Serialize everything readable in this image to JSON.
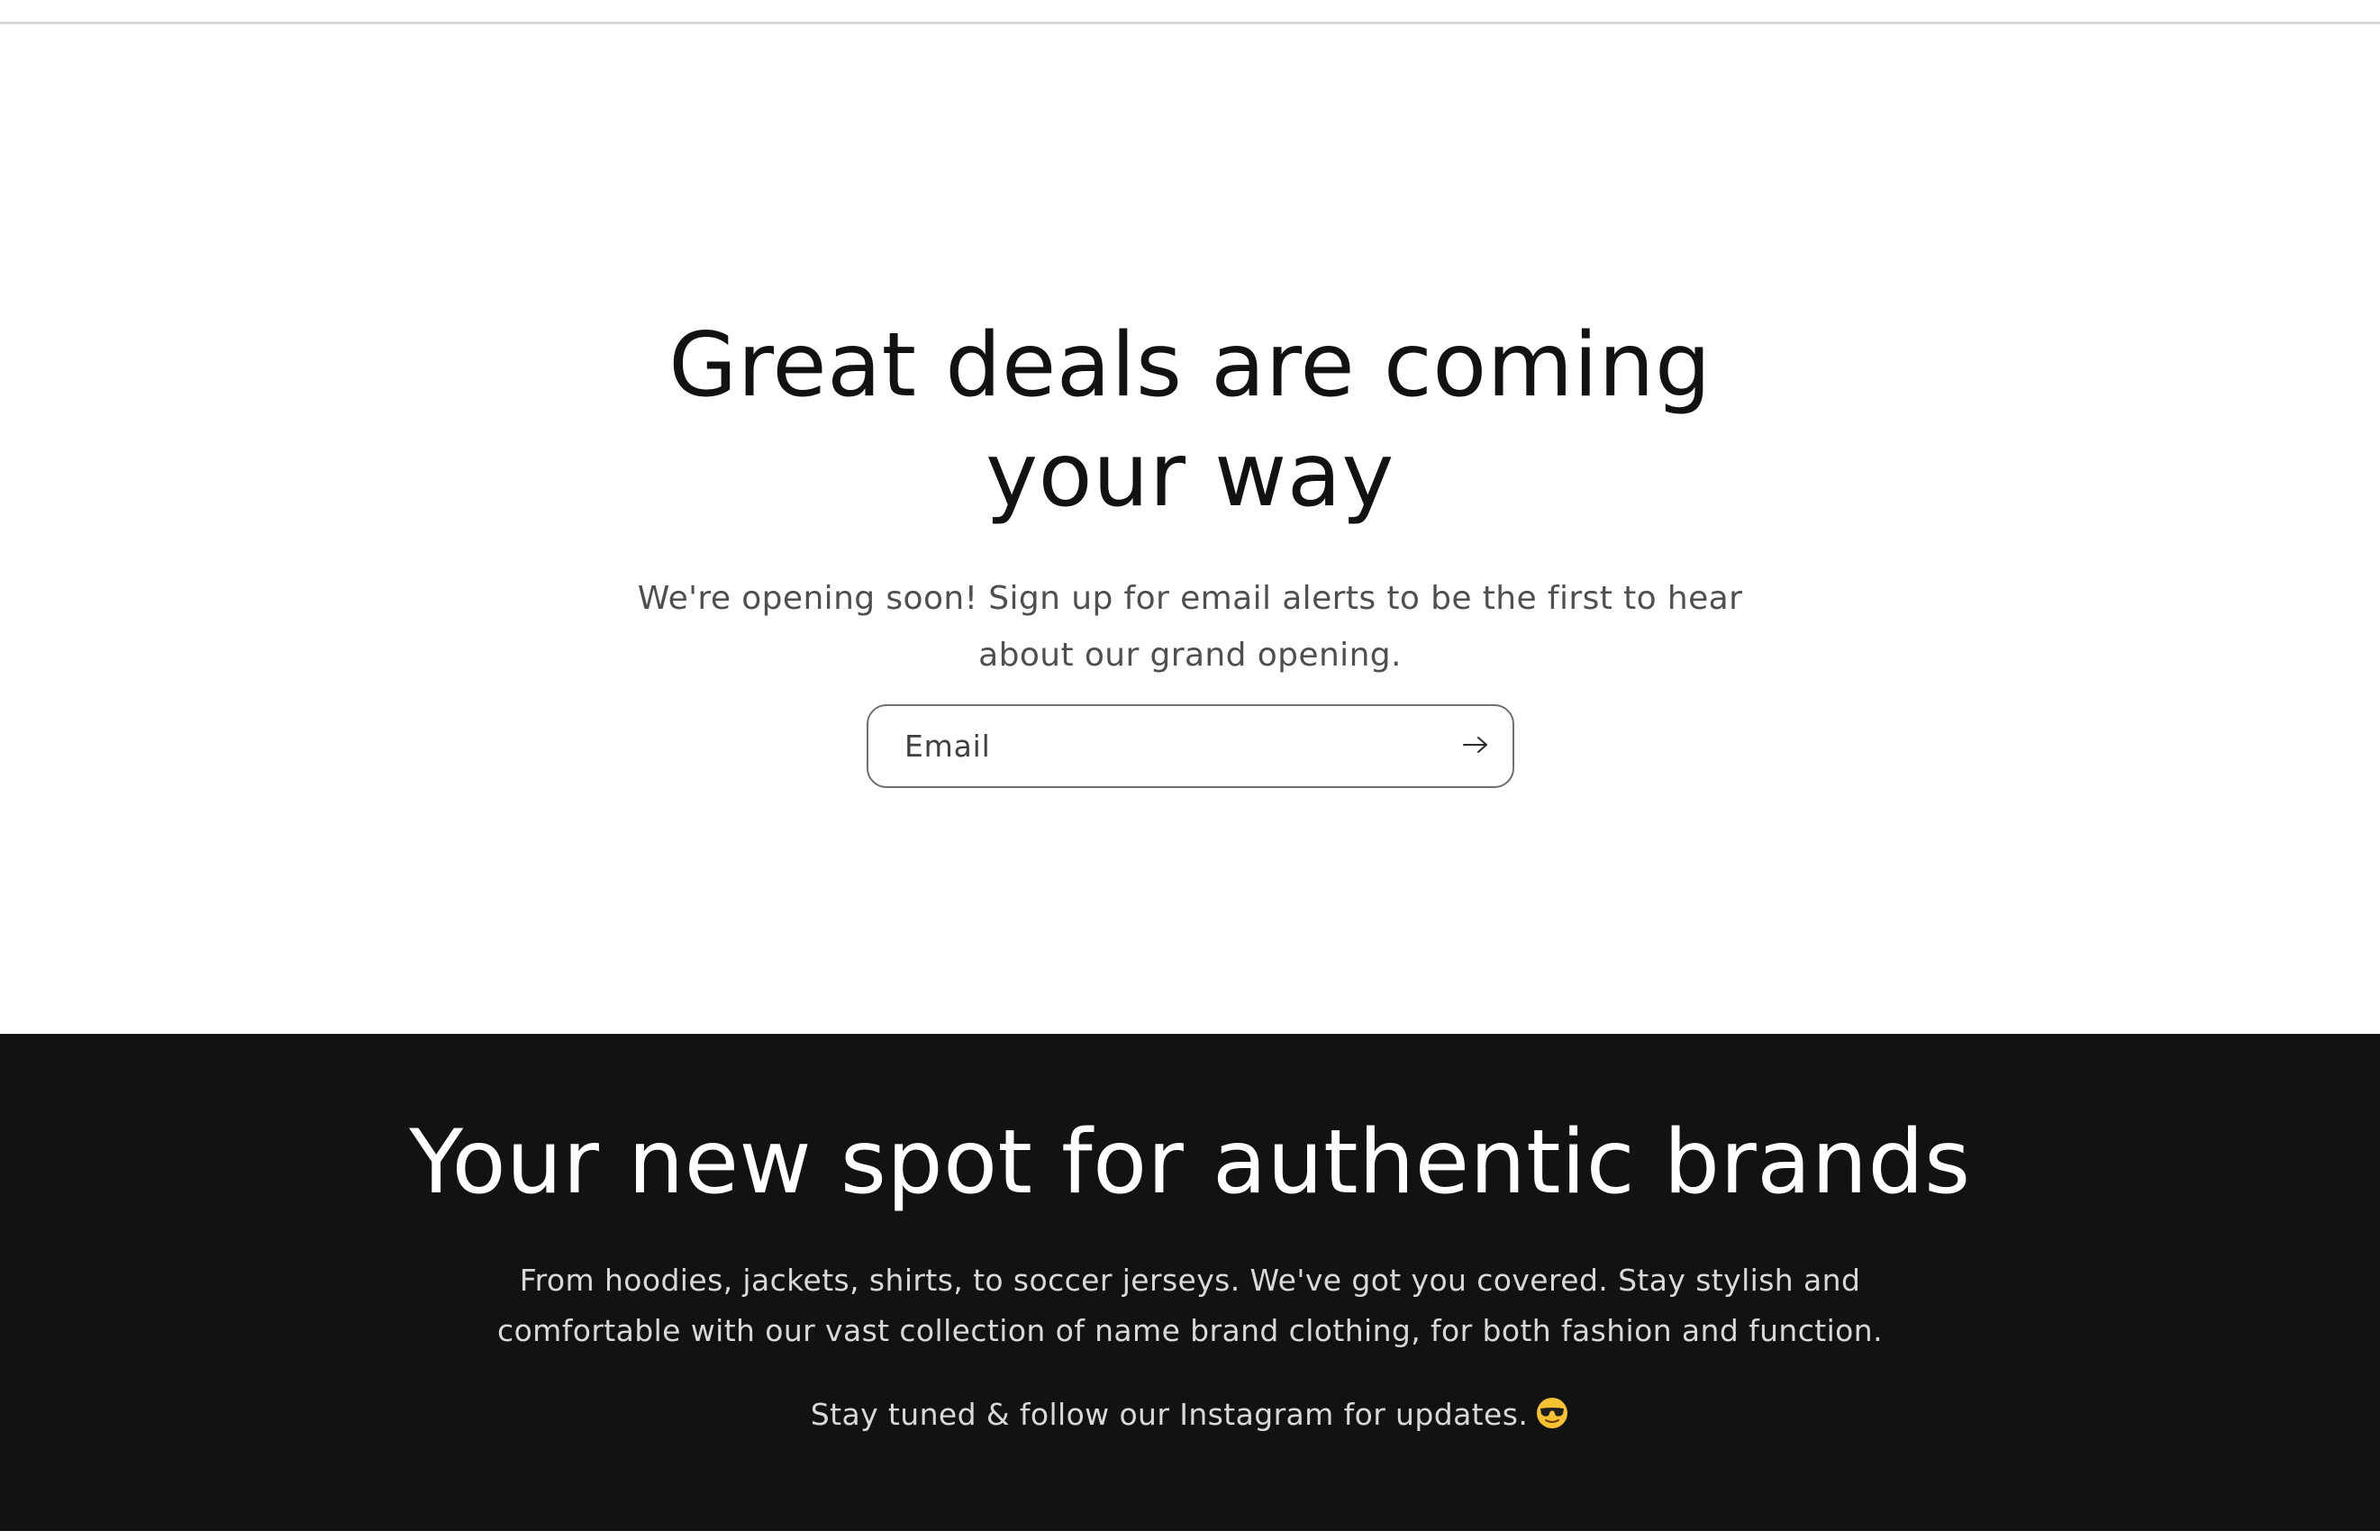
{
  "hero": {
    "title": "Great deals are coming your way",
    "subtitle": "We're opening soon! Sign up for email alerts to be the first to hear about our grand opening.",
    "email_form": {
      "label": "Email",
      "input_value": "",
      "submit_icon": "arrow-right-icon"
    }
  },
  "brand_section": {
    "title": "Your new spot for authentic brands",
    "description": "From hoodies, jackets, shirts, to soccer jerseys. We've got you covered. Stay stylish and comfortable with our vast collection of name brand clothing, for both fashion and function.",
    "followup": "Stay tuned & follow our Instagram for updates.",
    "followup_icon": "sunglasses-face-emoji-icon"
  },
  "colors": {
    "page_background": "#ffffff",
    "heading_text": "#121212",
    "body_text": "#4f4f4f",
    "dark_band_background": "#121212",
    "dark_band_heading": "#ffffff",
    "dark_band_text": "#d9d9d9",
    "input_border": "#6f6f6f",
    "divider": "#d9d9d9"
  }
}
